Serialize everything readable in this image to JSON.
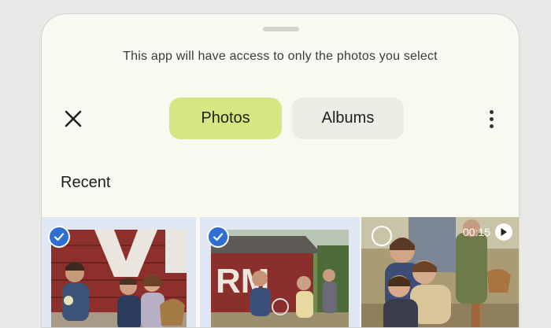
{
  "sheet": {
    "notice": "This app will have access to only the photos you select"
  },
  "toolbar": {
    "close_icon": "close-icon",
    "more_icon": "more-vertical-icon",
    "tabs": [
      {
        "label": "Photos",
        "selected": true
      },
      {
        "label": "Albums",
        "selected": false
      }
    ]
  },
  "section": {
    "title": "Recent"
  },
  "grid": {
    "items": [
      {
        "type": "photo",
        "selected": true
      },
      {
        "type": "photo",
        "selected": true
      },
      {
        "type": "video",
        "selected": false,
        "duration": "00:15"
      }
    ]
  },
  "colors": {
    "accent_selected_tab": "#d7e683",
    "check_blue": "#2f6fd4",
    "sheet_bg": "#f9f8f1"
  }
}
